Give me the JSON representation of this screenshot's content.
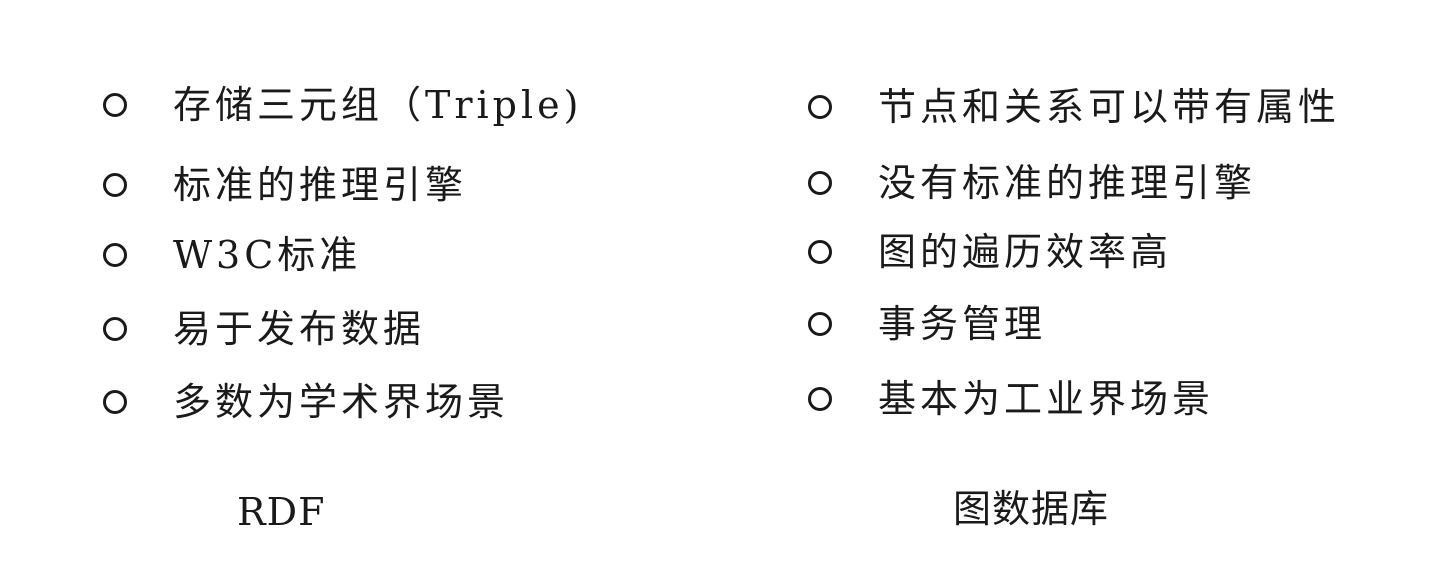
{
  "left": {
    "items": [
      "存储三元组（Triple)",
      "标准的推理引擎",
      "W3C标准",
      "易于发布数据",
      "多数为学术界场景"
    ],
    "caption": "RDF"
  },
  "right": {
    "items": [
      "节点和关系可以带有属性",
      "没有标准的推理引擎",
      "图的遍历效率高",
      "事务管理",
      "基本为工业界场景"
    ],
    "caption": "图数据库"
  }
}
